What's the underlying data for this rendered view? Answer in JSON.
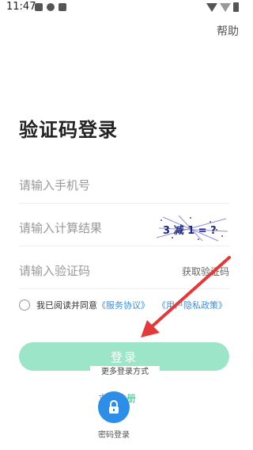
{
  "status": {
    "time": "11:47"
  },
  "header": {
    "help": "帮助"
  },
  "title": "验证码登录",
  "fields": {
    "phone_placeholder": "请输入手机号",
    "calc_placeholder": "请输入计算结果",
    "code_placeholder": "请输入验证码",
    "get_code": "获取验证码"
  },
  "captcha": {
    "text": "3 减 1 = ?"
  },
  "agreement": {
    "prefix": "我已阅读并同意",
    "service": "《服务协议》",
    "privacy": "《用户隐私政策》"
  },
  "login_button": "登录",
  "more_methods": "更多登录方式",
  "register": "立即注册",
  "password_login": "密码登录",
  "colors": {
    "accent": "#2fbf82",
    "button": "#9de5c8",
    "link": "#3b8fd9",
    "arrow": "#e03a3a"
  }
}
